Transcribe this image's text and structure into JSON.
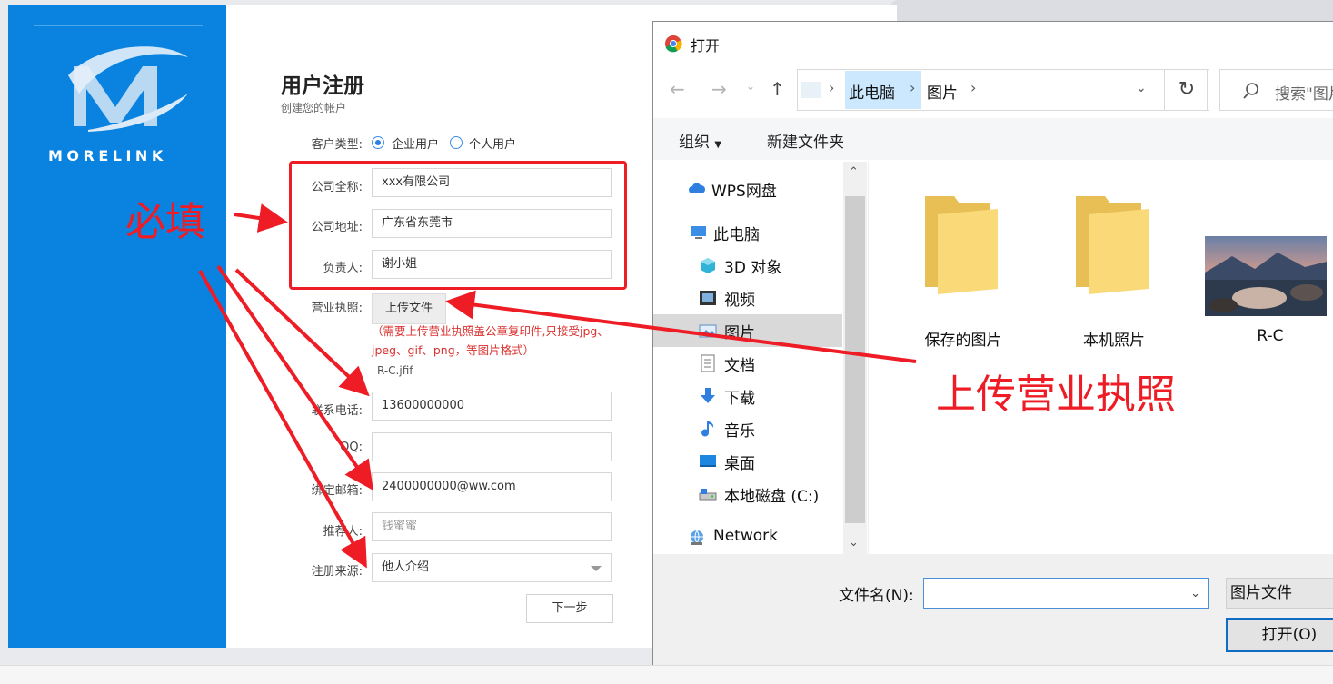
{
  "registration": {
    "title": "用户注册",
    "subtitle": "创建您的帐户",
    "logo_text": "MORELINK",
    "customer_type_label": "客户类型:",
    "radio_enterprise": "企业用户",
    "radio_personal": "个人用户",
    "company_name_label": "公司全称:",
    "company_name_value": "xxx有限公司",
    "company_address_label": "公司地址:",
    "company_address_value": "广东省东莞市",
    "contact_person_label": "负责人:",
    "contact_person_value": "谢小姐",
    "license_label": "营业执照:",
    "upload_button": "上传文件",
    "license_hint": "（需要上传营业执照盖公章复印件,只接受jpg、jpeg、gif、png，等图片格式）",
    "uploaded_file": "R-C.jfif",
    "phone_label": "联系电话:",
    "phone_value": "13600000000",
    "qq_label": "QQ:",
    "qq_value": "",
    "email_label": "绑定邮箱:",
    "email_value": "2400000000@ww.com",
    "referrer_label": "推荐人:",
    "referrer_placeholder": "钱蜜蜜",
    "source_label": "注册来源:",
    "source_value": "他人介绍",
    "next_button": "下一步"
  },
  "annotations": {
    "required_text": "必填",
    "upload_text": "上传营业执照",
    "color": "#ee1c25"
  },
  "dialog": {
    "title": "打开",
    "breadcrumb": [
      "此电脑",
      "图片"
    ],
    "search_placeholder": "搜索\"图片\"",
    "toolbar_organize": "组织",
    "toolbar_new_folder": "新建文件夹",
    "nav_items": [
      {
        "label": "WPS网盘",
        "icon": "cloud-icon"
      },
      {
        "label": "此电脑",
        "icon": "computer-icon"
      },
      {
        "label": "3D 对象",
        "icon": "3d-objects-icon"
      },
      {
        "label": "视频",
        "icon": "video-icon"
      },
      {
        "label": "图片",
        "icon": "pictures-icon",
        "selected": true
      },
      {
        "label": "文档",
        "icon": "document-icon"
      },
      {
        "label": "下载",
        "icon": "download-icon"
      },
      {
        "label": "音乐",
        "icon": "music-icon"
      },
      {
        "label": "桌面",
        "icon": "desktop-icon"
      },
      {
        "label": "本地磁盘 (C:)",
        "icon": "disk-icon"
      },
      {
        "label": "Network",
        "icon": "network-icon"
      }
    ],
    "files": [
      {
        "label": "保存的图片",
        "icon": "folder-icon"
      },
      {
        "label": "本机照片",
        "icon": "folder-icon"
      },
      {
        "label": "R-C",
        "icon": "image-thumbnail"
      }
    ],
    "filename_label": "文件名(N):",
    "filename_value": "",
    "filetype_value": "图片文件",
    "open_button": "打开(O)"
  }
}
